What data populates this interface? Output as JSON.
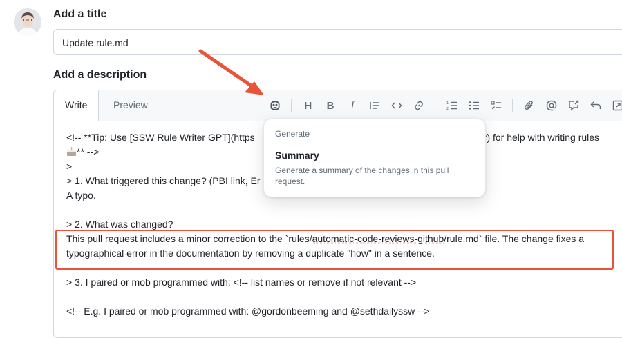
{
  "page": {
    "title_label": "Add a title",
    "title_value": "Update rule.md",
    "description_label": "Add a description"
  },
  "editor": {
    "tabs": [
      {
        "label": "Write",
        "active": true
      },
      {
        "label": "Preview",
        "active": false
      }
    ],
    "toolbar_icons": [
      "copilot-icon",
      "heading-icon",
      "bold-icon",
      "italic-icon",
      "quote-icon",
      "code-icon",
      "link-icon",
      "ordered-list-icon",
      "unordered-list-icon",
      "task-list-icon",
      "attach-icon",
      "mention-icon",
      "reference-icon",
      "undo-icon",
      "fullscreen-icon"
    ],
    "lines": {
      "l1a": "<!--  **Tip: Use [SSW Rule Writer GPT](https",
      "l1b": "iter) for help with writing rules",
      "l2": "** -->",
      "l3": ">",
      "l4": "> 1. What triggered this change? (PBI link, Er",
      "l5": "A typo.",
      "l6": "> 2. What was changed?",
      "l7a": "This pull request includes a minor correction to the `rules/",
      "l7b": "automatic-code-reviews-github",
      "l7c": "/rule.md` file. The change fixes a",
      "l8": "typographical error in the documentation by removing a duplicate \"how\" in a sentence.",
      "l9": "> 3. I paired or mob programmed with: <!-- list names or remove if not relevant -->",
      "l10": "<!-- E.g. I paired or mob programmed with: @gordonbeeming and @sethdailyssw -->"
    }
  },
  "popup": {
    "heading": "Generate",
    "item_title": "Summary",
    "item_description": "Generate a summary of the changes in this pull request."
  },
  "colors": {
    "annotation": "#e8543a",
    "border": "#d0d7de",
    "muted": "#636c76"
  }
}
